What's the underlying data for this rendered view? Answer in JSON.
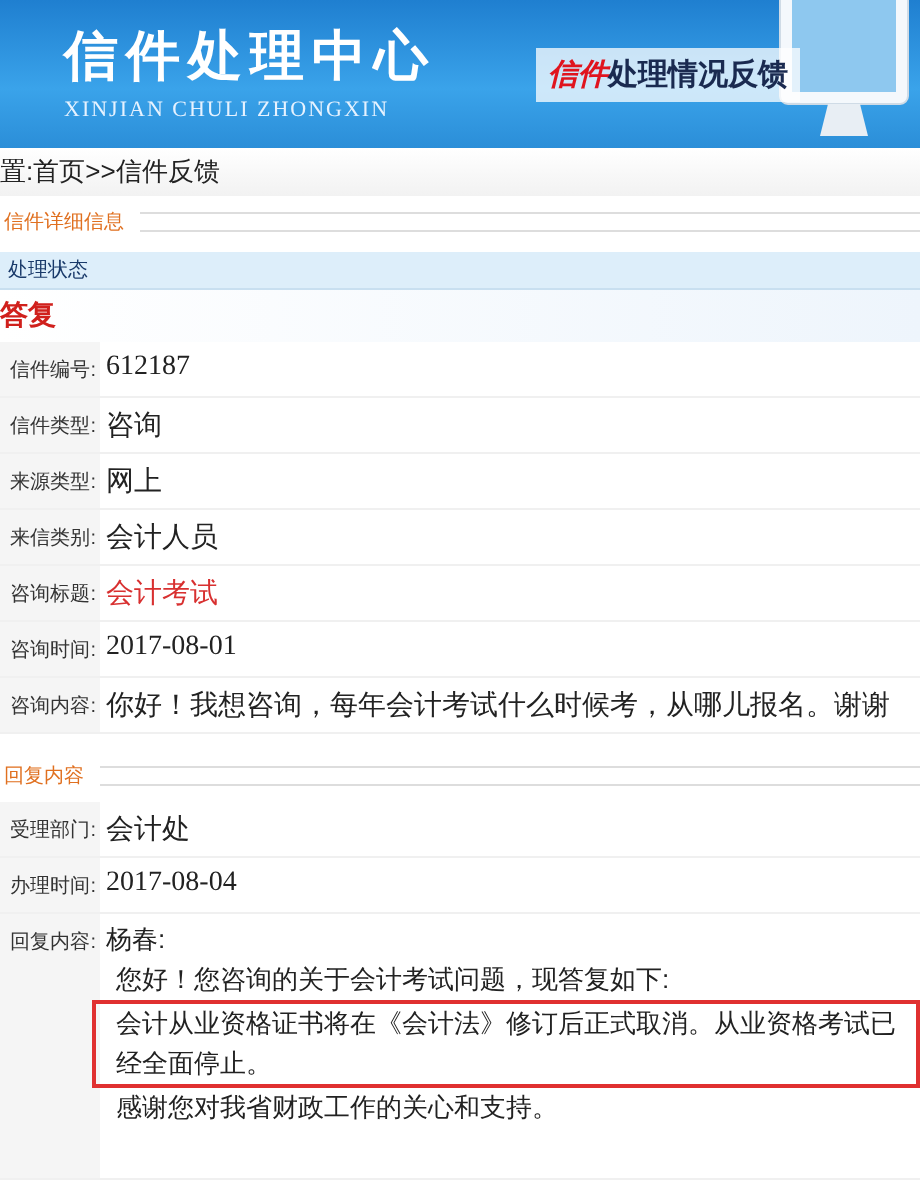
{
  "header": {
    "title": "信件处理中心",
    "subtitle": "XINJIAN CHULI ZHONGXIN",
    "banner_accent": "信件",
    "banner_rest": "处理情况反馈"
  },
  "breadcrumb": "置:首页>>信件反馈",
  "detail_section": {
    "title": "信件详细信息",
    "status_bar": "处理状态",
    "status_heading": "答复",
    "fields": [
      {
        "label": "信件编号:",
        "value": "612187",
        "emphasis": false
      },
      {
        "label": "信件类型:",
        "value": "咨询",
        "emphasis": false
      },
      {
        "label": "来源类型:",
        "value": "网上",
        "emphasis": false
      },
      {
        "label": "来信类别:",
        "value": "会计人员",
        "emphasis": false
      },
      {
        "label": "咨询标题:",
        "value": "会计考试",
        "emphasis": true
      },
      {
        "label": "咨询时间:",
        "value": "2017-08-01",
        "emphasis": false
      },
      {
        "label": "咨询内容:",
        "value": "你好！我想咨询，每年会计考试什么时候考，从哪儿报名。谢谢",
        "emphasis": false
      }
    ]
  },
  "reply_section": {
    "title": "回复内容",
    "fields": [
      {
        "label": "受理部门:",
        "value": "会计处",
        "emphasis": false
      },
      {
        "label": "办理时间:",
        "value": "2017-08-04",
        "emphasis": false
      }
    ],
    "reply_label": "回复内容:",
    "reply_lines": [
      {
        "text": "杨春:",
        "highlighted": false
      },
      {
        "text": "您好！您咨询的关于会计考试问题，现答复如下:",
        "highlighted": false
      },
      {
        "text": "会计从业资格证书将在《会计法》修订后正式取消。从业资格考试已经全面停止。",
        "highlighted": true
      },
      {
        "text": "感谢您对我省财政工作的关心和支持。",
        "highlighted": false
      }
    ]
  }
}
